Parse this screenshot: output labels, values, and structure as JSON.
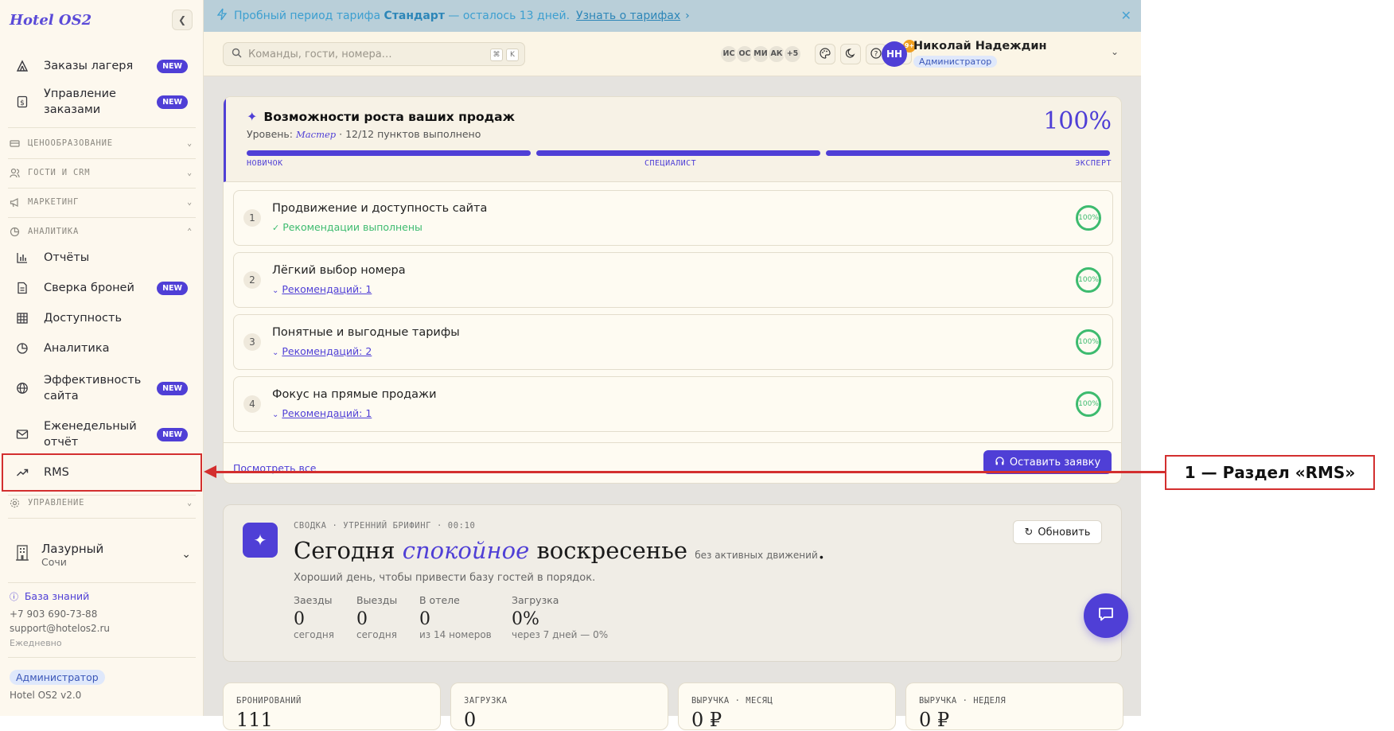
{
  "app": {
    "logo": "Hotel OS2",
    "version": "Hotel OS2 v2.0"
  },
  "sidebar": {
    "items_top": [
      {
        "label": "Заказы лагеря",
        "badge": "NEW",
        "icon": "camp-icon"
      },
      {
        "label": "Управление заказами",
        "badge": "NEW",
        "icon": "dollar-receipt-icon"
      }
    ],
    "sections": {
      "pricing": "ЦЕНООБРАЗОВАНИЕ",
      "guests": "ГОСТИ И CRM",
      "marketing": "МАРКЕТИНГ",
      "analytics": "АНАЛИТИКА",
      "management": "УПРАВЛЕНИЕ"
    },
    "analytics_items": [
      {
        "label": "Отчёты",
        "badge": "",
        "icon": "bar-chart-icon"
      },
      {
        "label": "Сверка броней",
        "badge": "NEW",
        "icon": "document-icon"
      },
      {
        "label": "Доступность",
        "badge": "",
        "icon": "grid-icon"
      },
      {
        "label": "Аналитика",
        "badge": "",
        "icon": "pie-chart-icon"
      },
      {
        "label": "Эффективность сайта",
        "badge": "NEW",
        "icon": "globe-icon"
      },
      {
        "label": "Еженедельный отчёт",
        "badge": "NEW",
        "icon": "mail-icon"
      },
      {
        "label": "RMS",
        "badge": "",
        "icon": "trend-up-icon"
      }
    ],
    "property": {
      "name": "Лазурный",
      "city": "Сочи"
    },
    "footer": {
      "kb_label": "База знаний",
      "phone": "+7 903 690-73-88",
      "email": "support@hotelos2.ru",
      "schedule": "Ежедневно",
      "role": "Администратор"
    }
  },
  "banner": {
    "text_pre": "Пробный период тарифа",
    "plan": "Стандарт",
    "text_post": "— осталось 13 дней.",
    "link": "Узнать о тарифах"
  },
  "topbar": {
    "search_placeholder": "Команды, гости, номера…",
    "kbd1": "⌘",
    "kbd2": "K",
    "avatars": [
      "ИС",
      "ОС",
      "МИ",
      "АК",
      "+5"
    ],
    "notif_badge": "9+",
    "user_initials": "НН",
    "user_name": "Николай Надеждин",
    "user_role": "Администратор"
  },
  "growth": {
    "title": "Возможности роста ваших продаж",
    "level_label": "Уровень:",
    "level": "Мастер",
    "progress_text": "· 12/12 пунктов выполнено",
    "percent": "100%",
    "progress": 1.0,
    "stages": [
      "НОВИЧОК",
      "СПЕЦИАЛИСТ",
      "ЭКСПЕРТ"
    ],
    "items": [
      {
        "num": "1",
        "title": "Продвижение и доступность сайта",
        "sub": "Рекомендации выполнены",
        "done": true,
        "pct": "100%"
      },
      {
        "num": "2",
        "title": "Лёгкий выбор номера",
        "sub": "Рекомендаций: 1",
        "done": false,
        "pct": "100%"
      },
      {
        "num": "3",
        "title": "Понятные и выгодные тарифы",
        "sub": "Рекомендаций: 2",
        "done": false,
        "pct": "100%"
      },
      {
        "num": "4",
        "title": "Фокус на прямые продажи",
        "sub": "Рекомендаций: 1",
        "done": false,
        "pct": "100%"
      }
    ],
    "view_all": "Посмотреть все",
    "apply": "Оставить заявку"
  },
  "briefing": {
    "meta": "СВОДКА · УТРЕННИЙ БРИФИНГ · 00:10",
    "h_pre": "Сегодня",
    "h_em": "спокойное",
    "h_post": "воскресенье",
    "h_small": "без активных движений",
    "h_dot": ".",
    "sub": "Хороший день, чтобы привести базу гостей в порядок.",
    "refresh": "Обновить",
    "stats": [
      {
        "k": "Заезды",
        "v": "0",
        "s": "сегодня"
      },
      {
        "k": "Выезды",
        "v": "0",
        "s": "сегодня"
      },
      {
        "k": "В отеле",
        "v": "0",
        "s": "из 14 номеров"
      },
      {
        "k": "Загрузка",
        "v": "0%",
        "s": "через 7 дней — 0%"
      }
    ]
  },
  "kpis": [
    {
      "k": "БРОНИРОВАНИЙ",
      "v": "111"
    },
    {
      "k": "ЗАГРУЗКА",
      "v": "0"
    },
    {
      "k": "ВЫРУЧКА · МЕСЯЦ",
      "v": "0 ₽"
    },
    {
      "k": "ВЫРУЧКА · НЕДЕЛЯ",
      "v": "0 ₽"
    }
  ],
  "annotation": {
    "label": "1 — Раздел «RMS»",
    "color": "#d32f2f"
  },
  "colors": {
    "accent": "#4f3fd6",
    "success": "#3dbb6f",
    "banner": "#3d9fd0"
  }
}
